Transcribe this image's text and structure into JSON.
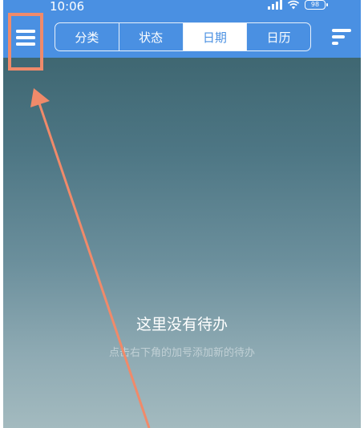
{
  "status_bar": {
    "time": "10:06",
    "battery": "98"
  },
  "tabs": [
    {
      "label": "分类"
    },
    {
      "label": "状态"
    },
    {
      "label": "日期",
      "active": true
    },
    {
      "label": "日历"
    }
  ],
  "empty_state": {
    "title": "这里没有待办",
    "hint": "点击右下角的加号添加新的待办"
  },
  "colors": {
    "header_blue": "#4a90e2",
    "annotation": "#f08a6a"
  },
  "icons": {
    "menu": "hamburger-menu-icon",
    "sort": "sort-icon",
    "signal": "cell-signal-icon",
    "wifi": "wifi-icon",
    "battery": "battery-icon"
  }
}
